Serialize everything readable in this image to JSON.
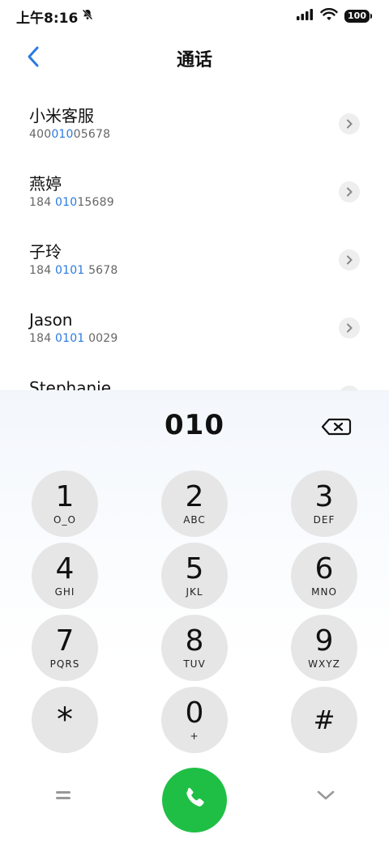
{
  "status": {
    "time": "上午8:16",
    "battery": "100"
  },
  "header": {
    "title": "通话"
  },
  "contacts": [
    {
      "name": "小米客服",
      "number_pre": "400",
      "number_hl": "010",
      "number_post": "05678"
    },
    {
      "name": "燕婷",
      "number_pre": "184 ",
      "number_hl": "010",
      "number_post": "15689"
    },
    {
      "name": "子玲",
      "number_pre": "184 ",
      "number_hl": "0101",
      "number_post": " 5678"
    },
    {
      "name": "Jason",
      "number_pre": "184 ",
      "number_hl": "0101",
      "number_post": " 0029"
    },
    {
      "name": "Stephanie",
      "number_pre": "",
      "number_hl": "",
      "number_post": ""
    }
  ],
  "dialer": {
    "input": "010",
    "keys": [
      {
        "digit": "1",
        "letters": "O_O"
      },
      {
        "digit": "2",
        "letters": "ABC"
      },
      {
        "digit": "3",
        "letters": "DEF"
      },
      {
        "digit": "4",
        "letters": "GHI"
      },
      {
        "digit": "5",
        "letters": "JKL"
      },
      {
        "digit": "6",
        "letters": "MNO"
      },
      {
        "digit": "7",
        "letters": "PQRS"
      },
      {
        "digit": "8",
        "letters": "TUV"
      },
      {
        "digit": "9",
        "letters": "WXYZ"
      },
      {
        "digit": "*",
        "letters": ""
      },
      {
        "digit": "0",
        "letters": "+"
      },
      {
        "digit": "#",
        "letters": ""
      }
    ]
  },
  "colors": {
    "accent": "#2a7ae2",
    "call": "#1fbf45",
    "key_bg": "#e6e6e6"
  },
  "icons": {
    "status_mute": "bell-slash-icon",
    "signal": "signal-bars-icon",
    "wifi": "wifi-icon",
    "back": "chevron-left-icon",
    "chevron": "chevron-right-icon",
    "backspace": "backspace-icon",
    "menu": "equals-icon",
    "call": "phone-icon",
    "collapse": "chevron-down-icon"
  }
}
